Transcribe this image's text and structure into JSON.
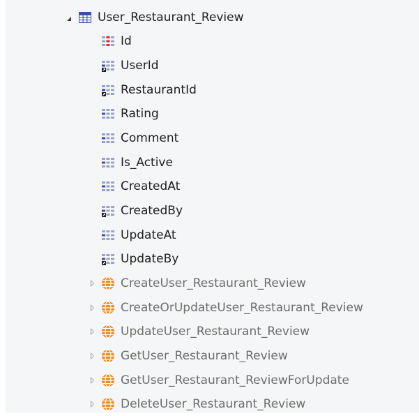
{
  "tree": {
    "root": {
      "label": "User_Restaurant_Review",
      "icon": "entity-table-icon",
      "expanded": true
    },
    "attributes": [
      {
        "label": "Id",
        "icon": "primary-key-attribute-icon"
      },
      {
        "label": "UserId",
        "icon": "reference-attribute-icon"
      },
      {
        "label": "RestaurantId",
        "icon": "reference-attribute-icon"
      },
      {
        "label": "Rating",
        "icon": "attribute-icon"
      },
      {
        "label": "Comment",
        "icon": "attribute-icon"
      },
      {
        "label": "Is_Active",
        "icon": "attribute-icon"
      },
      {
        "label": "CreatedAt",
        "icon": "attribute-icon"
      },
      {
        "label": "CreatedBy",
        "icon": "reference-attribute-icon"
      },
      {
        "label": "UpdateAt",
        "icon": "attribute-icon"
      },
      {
        "label": "UpdateBy",
        "icon": "reference-attribute-icon"
      }
    ],
    "actions": [
      {
        "label": "CreateUser_Restaurant_Review",
        "icon": "entity-action-icon"
      },
      {
        "label": "CreateOrUpdateUser_Restaurant_Review",
        "icon": "entity-action-icon"
      },
      {
        "label": "UpdateUser_Restaurant_Review",
        "icon": "entity-action-icon"
      },
      {
        "label": "GetUser_Restaurant_Review",
        "icon": "entity-action-icon"
      },
      {
        "label": "GetUser_Restaurant_ReviewForUpdate",
        "icon": "entity-action-icon"
      },
      {
        "label": "DeleteUser_Restaurant_Review",
        "icon": "entity-action-icon"
      }
    ]
  },
  "colors": {
    "background": "#f5f6f7",
    "text": "#1e1e1e",
    "action_text": "#6d6d6d",
    "table_blue": "#3c4fa8",
    "key_red": "#d62b2b",
    "action_orange": "#f08a1c"
  }
}
